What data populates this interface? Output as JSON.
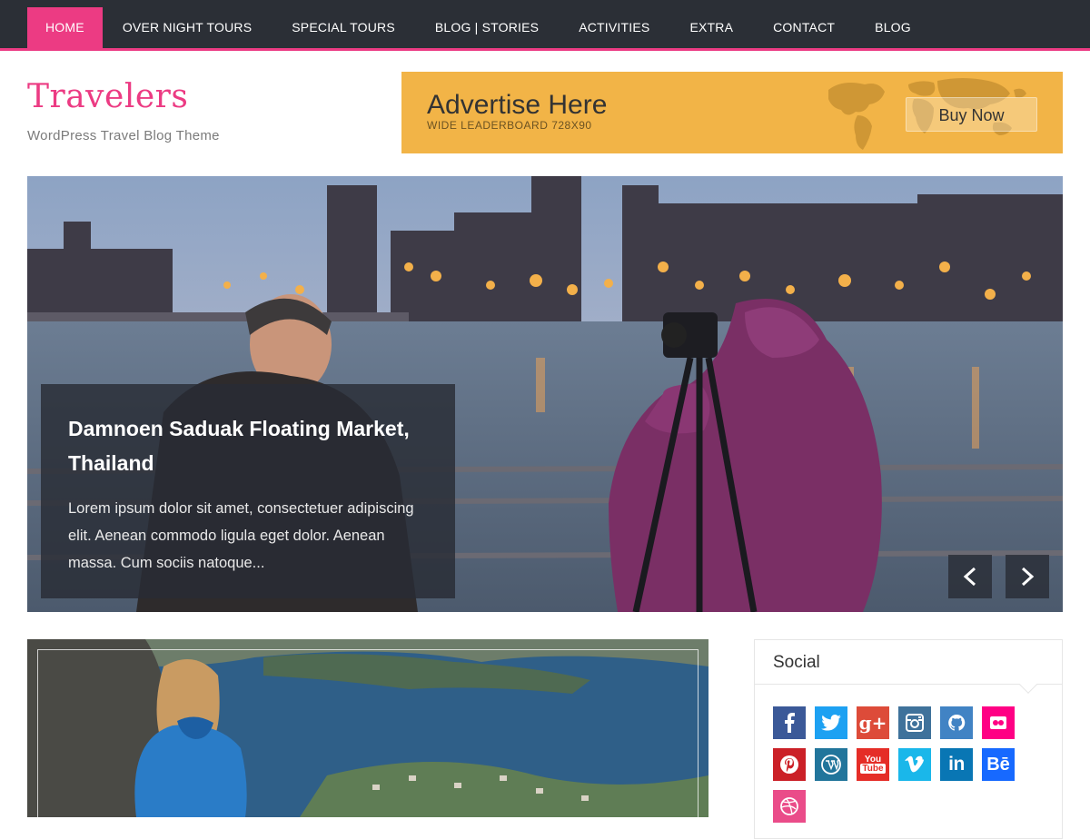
{
  "nav": {
    "items": [
      {
        "label": "HOME",
        "active": true
      },
      {
        "label": "OVER NIGHT TOURS",
        "active": false
      },
      {
        "label": "SPECIAL TOURS",
        "active": false
      },
      {
        "label": "BLOG | STORIES",
        "active": false
      },
      {
        "label": "ACTIVITIES",
        "active": false
      },
      {
        "label": "EXTRA",
        "active": false
      },
      {
        "label": "CONTACT",
        "active": false
      },
      {
        "label": "BLOG",
        "active": false
      }
    ]
  },
  "site": {
    "title": "Travelers",
    "description": "WordPress Travel Blog Theme"
  },
  "ad": {
    "title": "Advertise Here",
    "subtitle": "WIDE LEADERBOARD 728X90",
    "button": "Buy Now"
  },
  "slider": {
    "title": "Damnoen Saduak Floating Market, Thailand",
    "excerpt": "Lorem ipsum dolor sit amet, consectetuer adipiscing elit. Aenean commodo ligula eget dolor. Aenean massa. Cum sociis natoque...",
    "prev_icon": "chevron-left-icon",
    "next_icon": "chevron-right-icon"
  },
  "sidebar": {
    "social_title": "Social",
    "networks": [
      {
        "name": "facebook",
        "glyph": "f",
        "color": "#3b5998"
      },
      {
        "name": "twitter",
        "glyph": "t",
        "color": "#1da1f2"
      },
      {
        "name": "google-plus",
        "glyph": "g+",
        "color": "#dd4b39"
      },
      {
        "name": "instagram",
        "glyph": "ig",
        "color": "#3f729b"
      },
      {
        "name": "github",
        "glyph": "gh",
        "color": "#4183c4"
      },
      {
        "name": "flickr",
        "glyph": "fl",
        "color": "#ff0084"
      },
      {
        "name": "pinterest",
        "glyph": "p",
        "color": "#cb2027"
      },
      {
        "name": "wordpress",
        "glyph": "W",
        "color": "#21759b"
      },
      {
        "name": "youtube",
        "glyph": "You Tube",
        "color": "#e52d27"
      },
      {
        "name": "vimeo",
        "glyph": "v",
        "color": "#1ab7ea"
      },
      {
        "name": "linkedin",
        "glyph": "in",
        "color": "#0976b4"
      },
      {
        "name": "behance",
        "glyph": "Bē",
        "color": "#1769ff"
      },
      {
        "name": "dribbble",
        "glyph": "dr",
        "color": "#ea4c89"
      }
    ]
  }
}
